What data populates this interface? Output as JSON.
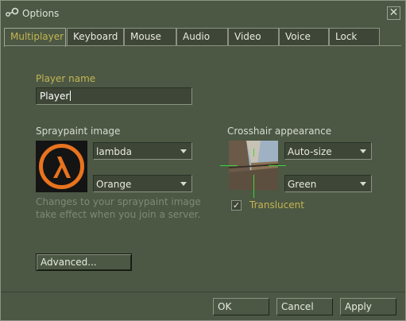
{
  "window": {
    "title": "Options",
    "close_glyph": "✕",
    "icon": "steam-icon"
  },
  "tabs": [
    {
      "label": "Multiplayer",
      "active": true
    },
    {
      "label": "Keyboard",
      "active": false
    },
    {
      "label": "Mouse",
      "active": false
    },
    {
      "label": "Audio",
      "active": false
    },
    {
      "label": "Video",
      "active": false
    },
    {
      "label": "Voice",
      "active": false
    },
    {
      "label": "Lock",
      "active": false
    }
  ],
  "player": {
    "name_label": "Player name",
    "name_value": "Player"
  },
  "spraypaint": {
    "label": "Spraypaint image",
    "image_value": "lambda",
    "color_value": "Orange",
    "note": "Changes to your spraypaint image take effect when you join a server.",
    "logo_color": "#e8731e"
  },
  "crosshair": {
    "label": "Crosshair appearance",
    "size_value": "Auto-size",
    "color_value": "Green",
    "translucent_label": "Translucent",
    "translucent_checked": true,
    "check_glyph": "✓",
    "crosshair_color": "#3bd63b"
  },
  "buttons": {
    "advanced": "Advanced...",
    "ok": "OK",
    "cancel": "Cancel",
    "apply": "Apply"
  },
  "colors": {
    "background": "#4c5844",
    "accent_text": "#c4b550"
  }
}
